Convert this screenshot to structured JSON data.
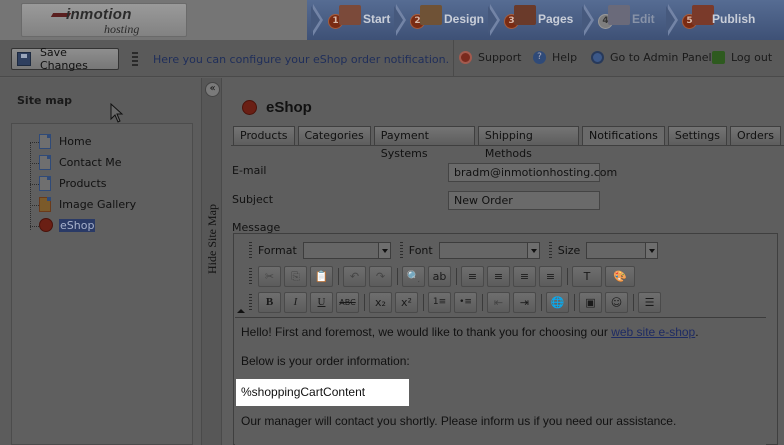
{
  "header": {
    "logo_brand": "inmotion",
    "logo_sub": "hosting",
    "steps": [
      {
        "num": "1",
        "label": "Start"
      },
      {
        "num": "2",
        "label": "Design"
      },
      {
        "num": "3",
        "label": "Pages"
      },
      {
        "num": "4",
        "label": "Edit"
      },
      {
        "num": "5",
        "label": "Publish"
      }
    ]
  },
  "toolbar": {
    "save_label": "Save Changes",
    "info_text": "Here you can configure your eShop order notification.",
    "links": {
      "support": "Support",
      "help": "Help",
      "admin": "Go to Admin Panel",
      "logout": "Log out"
    }
  },
  "sidebar": {
    "title": "Site map",
    "items": [
      {
        "label": "Home"
      },
      {
        "label": "Contact Me"
      },
      {
        "label": "Products"
      },
      {
        "label": "Image Gallery"
      },
      {
        "label": "eShop"
      }
    ],
    "hide_label": "Hide Site Map",
    "collapse_glyph": "«"
  },
  "main": {
    "title": "eShop",
    "tabs": [
      {
        "label": "Products"
      },
      {
        "label": "Categories"
      },
      {
        "label": "Payment Systems"
      },
      {
        "label": "Shipping Methods"
      },
      {
        "label": "Notifications"
      },
      {
        "label": "Settings"
      },
      {
        "label": "Orders"
      }
    ],
    "active_tab": "Notifications",
    "form": {
      "email_label": "E-mail",
      "email_value": "bradm@inmotionhosting.com",
      "subject_label": "Subject",
      "subject_value": "New Order",
      "message_label": "Message"
    },
    "editor": {
      "format_label": "Format",
      "font_label": "Font",
      "size_label": "Size",
      "buttons_row2": [
        "✂",
        "⎘",
        "📋",
        "↶",
        "↷",
        "🔍",
        "ab",
        "≡",
        "≡",
        "≡",
        "≡",
        "T",
        "🎨"
      ],
      "buttons_row3": [
        "B",
        "I",
        "U",
        "ABC",
        "x₂",
        "x²",
        "1≡",
        "•≡",
        "⇤",
        "⇥",
        "🌐",
        "▣",
        "☺",
        "☰"
      ],
      "content": {
        "line1_text": "Hello! First and foremost, we would like to thank you for choosing our ",
        "line1_link": "web site e-shop",
        "line1_end": ".",
        "line2": "Below is your order information:",
        "line3": "%shoppingCartContent",
        "line4": "Our manager will contact you shortly. Please inform us if you need our assistance."
      }
    }
  },
  "colors": {
    "overlay_gray": "#5e5e5e",
    "header_blue": "#4a5d82",
    "highlight": "#ffffff",
    "link": "#1e2b63"
  }
}
